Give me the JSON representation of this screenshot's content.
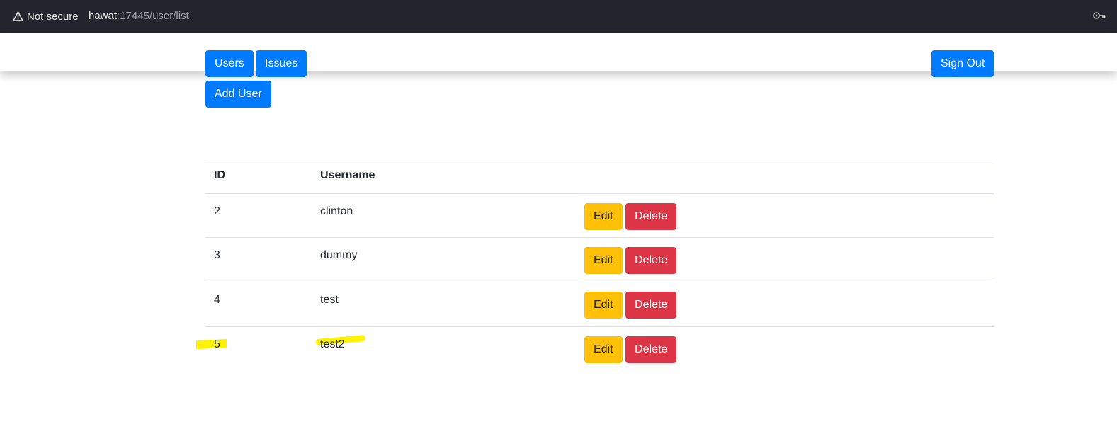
{
  "browser": {
    "security_label": "Not secure",
    "url_host": "hawat",
    "url_rest": ":17445/user/list"
  },
  "nav": {
    "users_label": "Users",
    "issues_label": "Issues",
    "signout_label": "Sign Out"
  },
  "toolbar": {
    "add_user_label": "Add User"
  },
  "table": {
    "headers": {
      "id": "ID",
      "username": "Username",
      "actions": ""
    },
    "rows": [
      {
        "id": "2",
        "username": "clinton",
        "edit_label": "Edit",
        "delete_label": "Delete"
      },
      {
        "id": "3",
        "username": "dummy",
        "edit_label": "Edit",
        "delete_label": "Delete"
      },
      {
        "id": "4",
        "username": "test",
        "edit_label": "Edit",
        "delete_label": "Delete"
      },
      {
        "id": "5",
        "username": "test2",
        "edit_label": "Edit",
        "delete_label": "Delete"
      }
    ]
  },
  "colors": {
    "primary": "#007bff",
    "warning": "#ffc107",
    "danger": "#dc3545",
    "chrome_bg": "#23252e",
    "highlight": "#fff200"
  }
}
